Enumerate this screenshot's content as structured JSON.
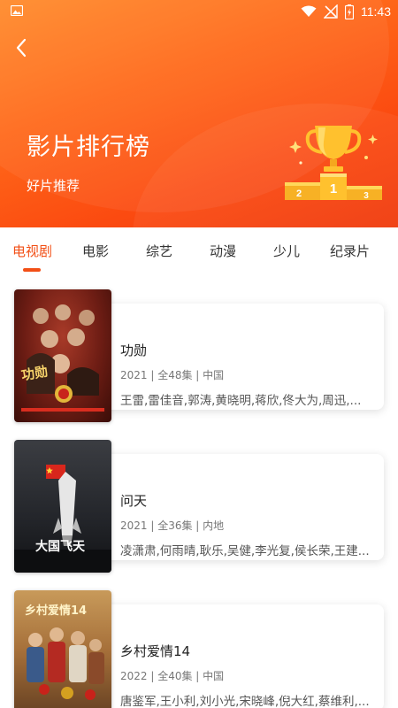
{
  "status_bar": {
    "time": "11:43"
  },
  "header": {
    "title": "影片排行榜",
    "subtitle": "好片推荐",
    "trophy_ranks": [
      "2",
      "1",
      "3"
    ]
  },
  "tabs": [
    {
      "label": "电视剧",
      "active": true
    },
    {
      "label": "电影",
      "active": false
    },
    {
      "label": "综艺",
      "active": false
    },
    {
      "label": "动漫",
      "active": false
    },
    {
      "label": "少儿",
      "active": false
    },
    {
      "label": "纪录片",
      "active": false
    }
  ],
  "items": [
    {
      "title": "功勋",
      "meta": "2021 | 全48集 | 中国",
      "cast": "王雷,雷佳音,郭涛,黄晓明,蒋欣,佟大为,周迅,...",
      "poster_text": "功勋"
    },
    {
      "title": "问天",
      "meta": "2021 | 全36集 | 内地",
      "cast": "凌潇肃,何雨晴,耿乐,吴健,李光复,侯长荣,王建...",
      "poster_text": "大国飞天"
    },
    {
      "title": "乡村爱情14",
      "meta": "2022 | 全40集 | 中国",
      "cast": "唐鉴军,王小利,刘小光,宋晓峰,倪大红,蔡维利,...",
      "poster_text": "乡村爱情14"
    }
  ],
  "colors": {
    "accent": "#f24f16",
    "header_start": "#ff8a2a",
    "header_end": "#f03a0c",
    "trophy_gold": "#ffc12e"
  }
}
